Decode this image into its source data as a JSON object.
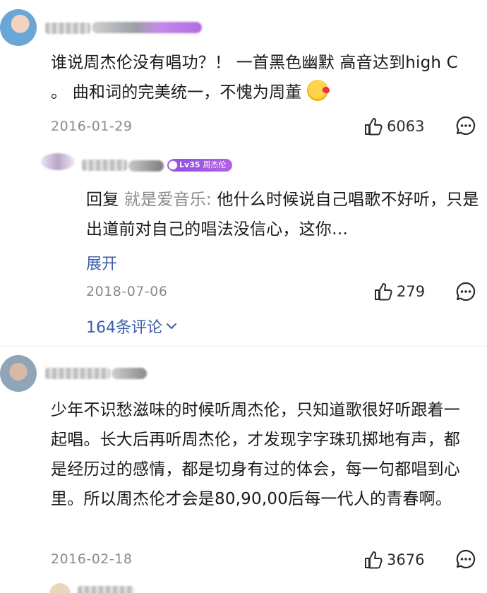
{
  "comments": [
    {
      "text": "谁说周杰伦没有唱功？！   一首黑色幽默 高音达到high C 。 曲和词的完美统一，不愧为周董",
      "emoji": "kissing-face-with-heart",
      "date": "2016-01-29",
      "likes": "6063",
      "reply": {
        "prefix": "回复",
        "to_user": "就是爱音乐:",
        "text": "他什么时候说自己唱歌不好听，只是出道前对自己的唱法没信心，这你…",
        "fan_badge": {
          "level_prefix": "Lv",
          "level": "35",
          "label": "周杰伦"
        },
        "expand_label": "展开",
        "date": "2018-07-06",
        "likes": "279"
      },
      "more_comments": "164条评论"
    },
    {
      "text": "少年不识愁滋味的时候听周杰伦，只知道歌很好听跟着一起唱。长大后再听周杰伦，才发现字字珠玑掷地有声，都是经历过的感情，都是切身有过的体会，每一句都唱到心里。所以周杰伦才会是80,90,00后每一代人的青春啊。",
      "date": "2016-02-18",
      "likes": "3676"
    }
  ],
  "colors": {
    "link": "#3b5ea8",
    "meta": "#8a8a8a",
    "badge": "#9b55e6"
  },
  "icons": {
    "like": "thumbs-up-icon",
    "reply": "comment-bubble-icon",
    "expand": "chevron-down-icon"
  }
}
